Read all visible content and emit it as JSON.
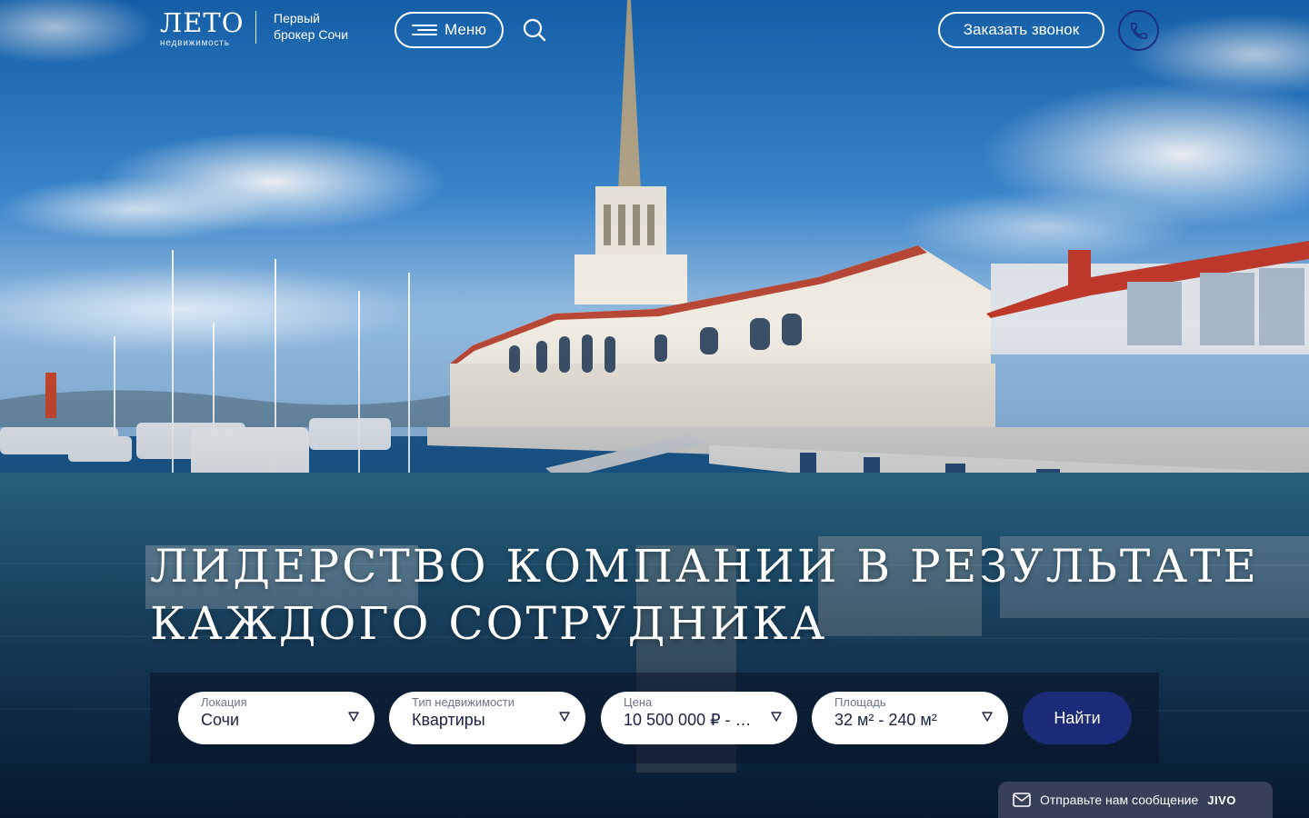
{
  "header": {
    "logo_word": "ЛЕТО",
    "logo_sub": "недвижимость",
    "tagline_line1": "Первый",
    "tagline_line2": "брокер Сочи",
    "menu_label": "Меню",
    "callback_label": "Заказать звонок",
    "icons": {
      "menu": "menu-lines-icon",
      "search": "search-icon",
      "phone": "phone-icon"
    }
  },
  "hero": {
    "headline_line1": "ЛИДЕРСТВО КОМПАНИИ  В РЕЗУЛЬТАТЕ",
    "headline_line2": "КАЖДОГО СОТРУДНИКА"
  },
  "search": {
    "location": {
      "label": "Локация",
      "value": "Сочи"
    },
    "type": {
      "label": "Тип недвижимости",
      "value": "Квартиры"
    },
    "price": {
      "label": "Цена",
      "value": "10 500 000 ₽ - 19..."
    },
    "area": {
      "label": "Площадь",
      "value": "32 м² - 240 м²"
    },
    "submit_label": "Найти",
    "caret_icon": "triangle-down-icon"
  },
  "chat": {
    "text": "Отправьте нам сообщение",
    "brand": "JIVO",
    "icon": "envelope-icon"
  },
  "colors": {
    "accent": "#1b2b78",
    "phone_ring": "#1c2f7f",
    "field_bg": "#ffffff",
    "panel_bg": "rgba(10,18,38,0.55)"
  }
}
